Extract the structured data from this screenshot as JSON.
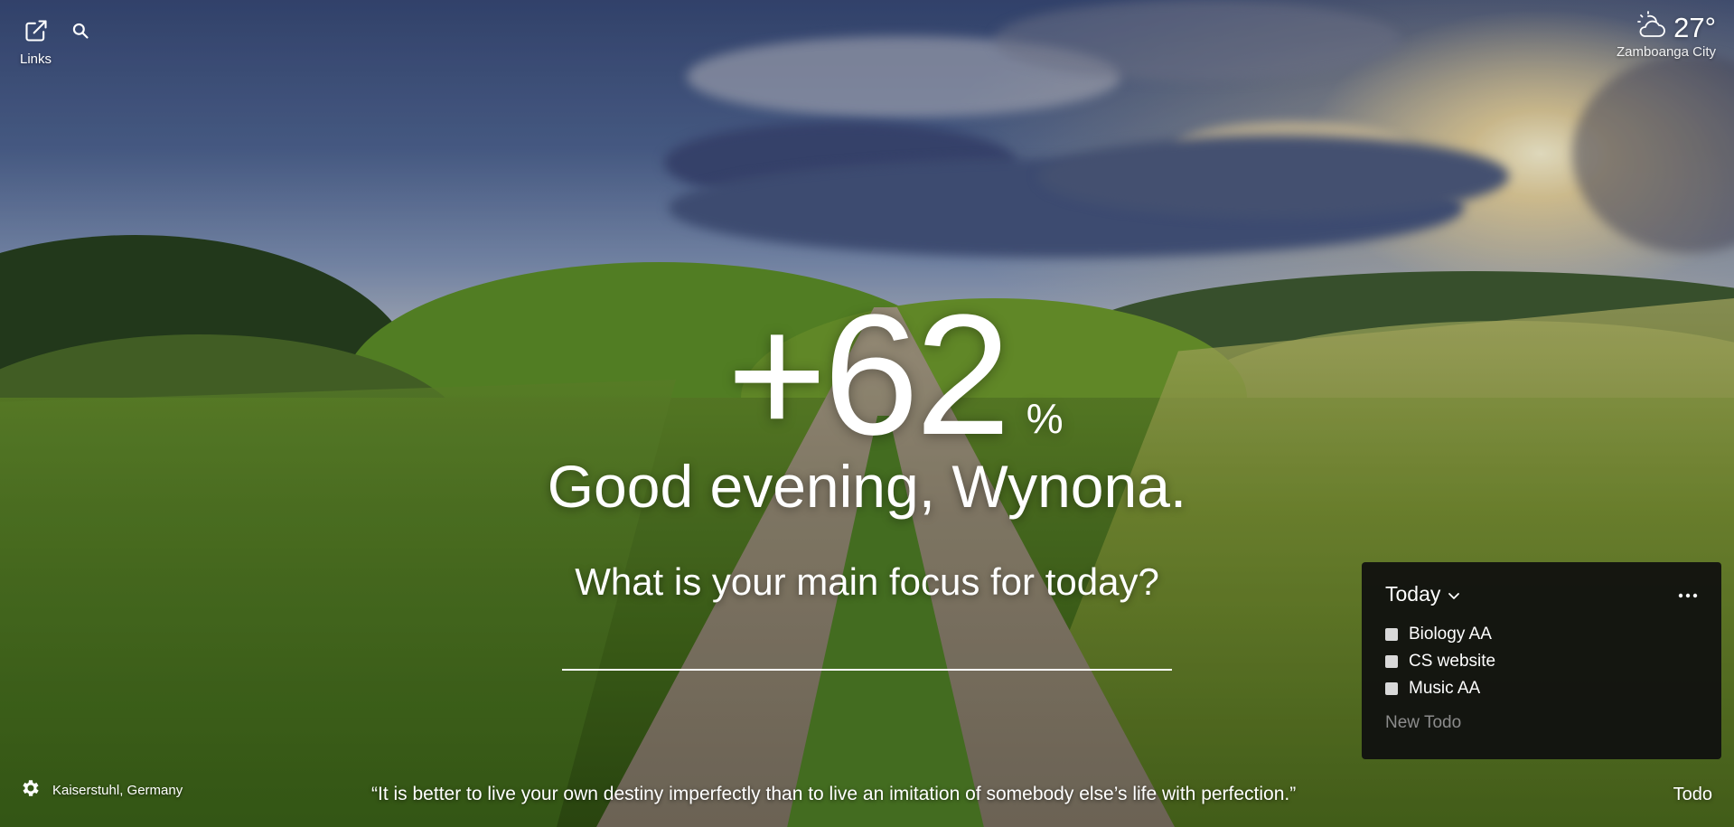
{
  "colors": {
    "text": "#ffffff",
    "todo_panel_bg": "#0f0f0f",
    "todo_placeholder": "#8c8c8c",
    "checkbox": "#d9d9d9"
  },
  "top_left": {
    "links_label": "Links",
    "links_icon": "external-link-icon",
    "search_icon": "search-icon"
  },
  "weather": {
    "icon": "partly-cloudy-icon",
    "temperature": "27°",
    "location": "Zamboanga City"
  },
  "center": {
    "metric_value": "+62",
    "metric_unit": "%",
    "greeting": "Good evening, Wynona.",
    "focus_question": "What is your main focus for today?",
    "focus_input_value": ""
  },
  "todo": {
    "list_name": "Today",
    "items": [
      {
        "label": "Biology AA",
        "done": false
      },
      {
        "label": "CS website",
        "done": false
      },
      {
        "label": "Music AA",
        "done": false
      }
    ],
    "new_placeholder": "New Todo"
  },
  "bottom": {
    "settings_icon": "gear-icon",
    "photo_location": "Kaiserstuhl, Germany",
    "quote": "“It is better to live your own destiny imperfectly than to live an imitation of somebody else’s life with perfection.”",
    "todo_toggle_label": "Todo"
  }
}
